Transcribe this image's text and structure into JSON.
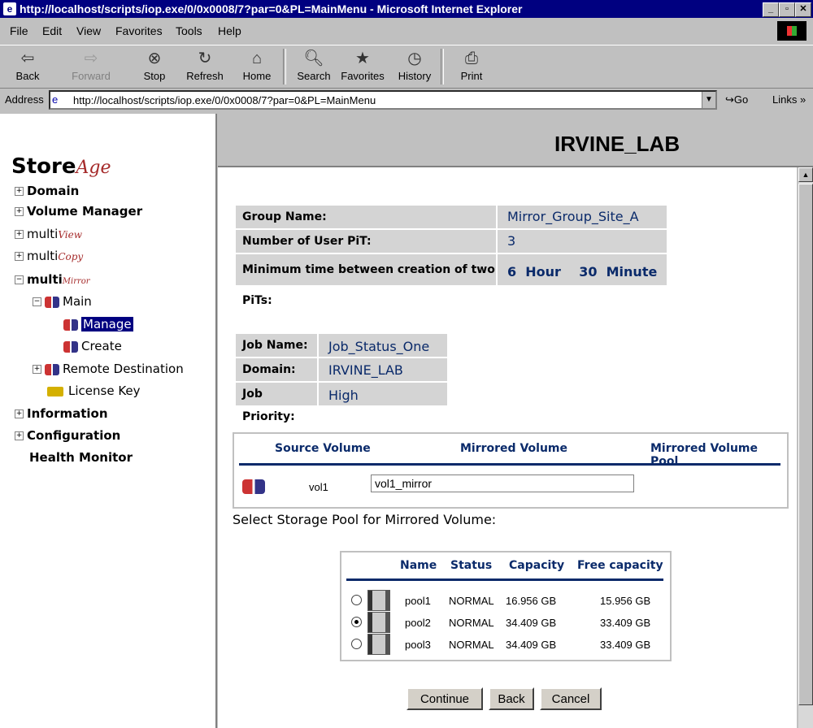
{
  "window": {
    "title": "http://localhost/scripts/iop.exe/0/0x0008/7?par=0&PL=MainMenu - Microsoft Internet Explorer"
  },
  "menu": [
    "File",
    "Edit",
    "View",
    "Favorites",
    "Tools",
    "Help"
  ],
  "toolbar": {
    "back": "Back",
    "forward": "Forward",
    "stop": "Stop",
    "refresh": "Refresh",
    "home": "Home",
    "search": "Search",
    "favorites": "Favorites",
    "history": "History",
    "print": "Print"
  },
  "address": {
    "label": "Address",
    "url": "http://localhost/scripts/iop.exe/0/0x0008/7?par=0&PL=MainMenu",
    "go": "Go",
    "links": "Links"
  },
  "logo": {
    "store": "Store",
    "age": "Age"
  },
  "nav": {
    "domain": "Domain",
    "volume_manager": "Volume Manager",
    "multi": "multi",
    "view": "View",
    "copy": "Copy",
    "mirror": "Mirror",
    "main": "Main",
    "manage": "Manage",
    "create": "Create",
    "remote_destination": "Remote Destination",
    "license_key": "License Key",
    "information": "Information",
    "configuration": "Configuration",
    "health_monitor": "Health Monitor"
  },
  "header": {
    "site": "IRVINE_LAB"
  },
  "group": {
    "group_name_label": "Group Name:",
    "group_name": "Mirror_Group_Site_A",
    "user_pit_label": "Number of User PiT:",
    "user_pit": "3",
    "min_time_label": "Minimum time between creation of two PiTs:",
    "min_time": "6  Hour    30  Minute"
  },
  "job": {
    "job_name_label": "Job Name:",
    "job_name": "Job_Status_One",
    "domain_label": "Domain:",
    "domain": "IRVINE_LAB",
    "priority_label": "Job Priority:",
    "priority": "High"
  },
  "mirror_table": {
    "headers": [
      "Source Volume",
      "Mirrored Volume",
      "Mirrored Volume Pool"
    ],
    "source": "vol1",
    "mirror_value": "vol1_mirror"
  },
  "select_label": "Select Storage Pool for Mirrored Volume:",
  "pool_table": {
    "headers": [
      "Name",
      "Status",
      "Capacity",
      "Free capacity"
    ],
    "rows": [
      {
        "name": "pool1",
        "status": "NORMAL",
        "capacity": "16.956 GB",
        "free": "15.956 GB",
        "selected": false
      },
      {
        "name": "pool2",
        "status": "NORMAL",
        "capacity": "34.409 GB",
        "free": "33.409 GB",
        "selected": true
      },
      {
        "name": "pool3",
        "status": "NORMAL",
        "capacity": "34.409 GB",
        "free": "33.409 GB",
        "selected": false
      }
    ]
  },
  "buttons": {
    "continue": "Continue",
    "back": "Back",
    "cancel": "Cancel"
  }
}
